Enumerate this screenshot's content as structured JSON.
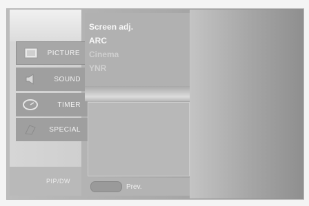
{
  "sidebar": {
    "items": [
      {
        "label": "PICTURE",
        "icon": "tv-picture-icon"
      },
      {
        "label": "SOUND",
        "icon": "sound-icon"
      },
      {
        "label": "TIMER",
        "icon": "timer-icon"
      },
      {
        "label": "SPECIAL",
        "icon": "special-icon"
      }
    ],
    "pip_label": "PIP/DW"
  },
  "submenu": {
    "options": [
      {
        "label": "Screen adj.",
        "enabled": true
      },
      {
        "label": "ARC",
        "enabled": true
      },
      {
        "label": "Cinema",
        "enabled": false
      },
      {
        "label": "YNR",
        "enabled": false
      }
    ]
  },
  "footer": {
    "prev_label": "Prev."
  },
  "colors": {
    "screen_bg": "#a9a9a9",
    "menu_bg": "#b1b1b1",
    "text_light": "#f7f7f7"
  }
}
